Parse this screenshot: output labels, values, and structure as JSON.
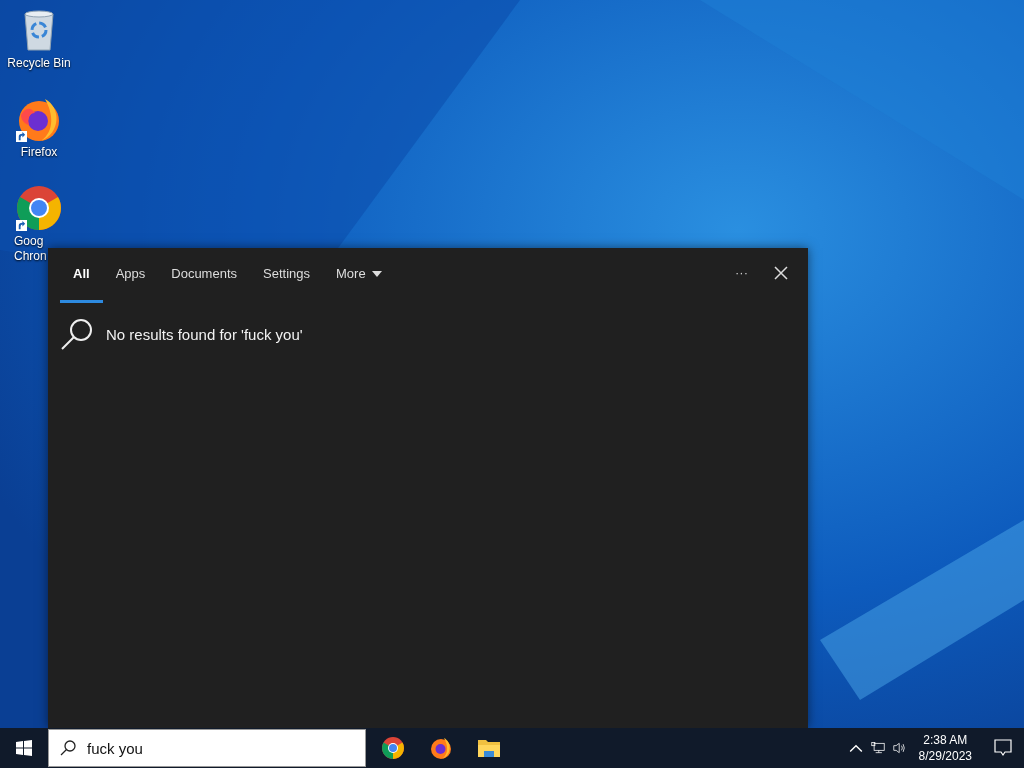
{
  "desktop_icons": [
    {
      "kind": "recycle",
      "label_lines": [
        "Recycle Bin"
      ],
      "shortcut": false
    },
    {
      "kind": "firefox",
      "label_lines": [
        "Firefox"
      ],
      "shortcut": true
    },
    {
      "kind": "chrome",
      "label_lines": [
        "Goog",
        "Chron"
      ],
      "shortcut": true
    }
  ],
  "search_panel": {
    "tabs": [
      {
        "label": "All",
        "selected": true
      },
      {
        "label": "Apps",
        "selected": false
      },
      {
        "label": "Documents",
        "selected": false
      },
      {
        "label": "Settings",
        "selected": false
      },
      {
        "label": "More",
        "selected": false,
        "dropdown": true
      }
    ],
    "more_options": "···",
    "message": "No results found for 'fuck you'"
  },
  "taskbar": {
    "search": {
      "value": "fuck you"
    },
    "apps": [
      {
        "kind": "chrome"
      },
      {
        "kind": "firefox"
      },
      {
        "kind": "explorer"
      }
    ],
    "time": "2:38 AM",
    "date": "8/29/2023"
  }
}
